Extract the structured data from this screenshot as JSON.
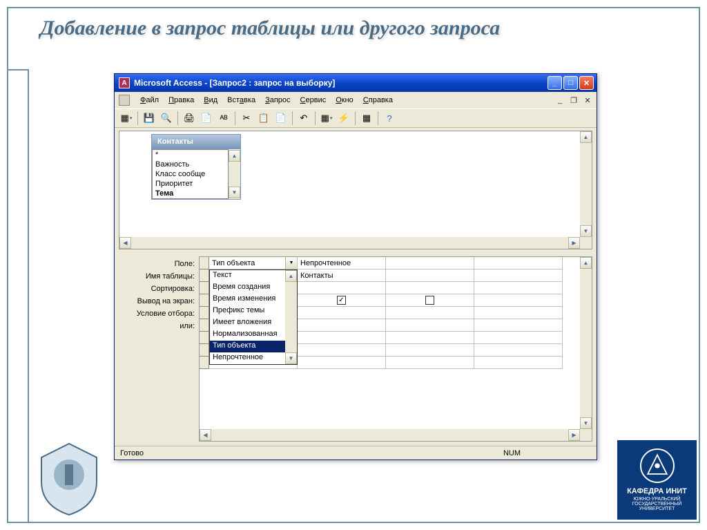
{
  "slide": {
    "title": "Добавление в запрос таблицы или другого запроса"
  },
  "window": {
    "title": "Microsoft Access - [Запрос2 : запрос на выборку]"
  },
  "menu": {
    "file": "Файл",
    "edit": "Правка",
    "view": "Вид",
    "insert": "Вставка",
    "query": "Запрос",
    "tools": "Сервис",
    "window": "Окно",
    "help": "Справка"
  },
  "table_box": {
    "title": "Контакты",
    "fields": [
      "*",
      "Важность",
      "Класс сообще",
      "Приоритет",
      "Тема"
    ]
  },
  "qbe_labels": {
    "field": "Поле:",
    "table": "Имя таблицы:",
    "sort": "Сортировка:",
    "show": "Вывод на экран:",
    "criteria": "Условие отбора:",
    "or": "или:"
  },
  "qbe": {
    "col1_field": "Тип объекта",
    "col2_field": "Непрочтенное",
    "col2_table": "Контакты",
    "col2_show": true,
    "col3_show": false
  },
  "dropdown_items": [
    "Текст",
    "Время создания",
    "Время изменения",
    "Префикс темы",
    "Имеет вложения",
    "Нормализованная",
    "Тип объекта",
    "Непрочтенное"
  ],
  "dropdown_selected": "Тип объекта",
  "status": {
    "ready": "Готово",
    "num": "NUM"
  },
  "logo_right": {
    "title": "КАФЕДРА ИНИТ",
    "sub": "ЮЖНО-УРАЛЬСКИЙ ГОСУДАРСТВЕННЫЙ УНИВЕРСИТЕТ"
  }
}
